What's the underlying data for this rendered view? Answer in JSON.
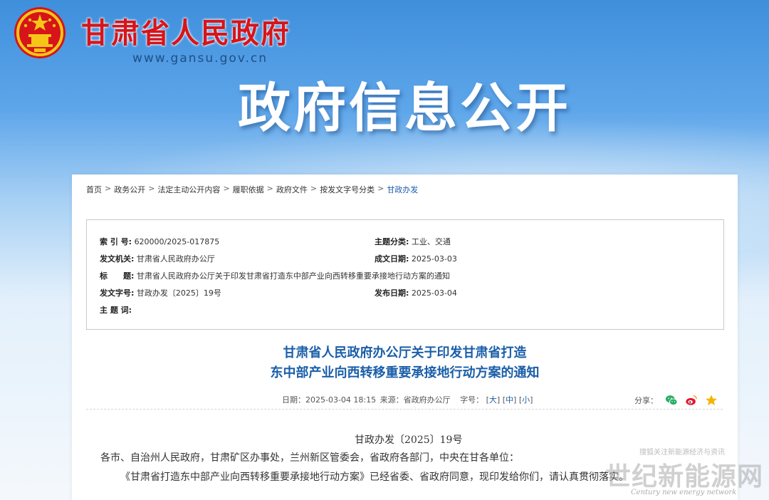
{
  "header": {
    "site_title": "甘肃省人民政府",
    "site_url": "www.gansu.gov.cn",
    "banner": "政府信息公开"
  },
  "breadcrumb": [
    "首页",
    "政务公开",
    "法定主动公开内容",
    "履职依据",
    "政府文件",
    "按发文字号分类",
    "甘政办发"
  ],
  "meta": {
    "index_label": "索 引 号:",
    "index_value": "620000/2025-017875",
    "topic_label": "主题分类:",
    "topic_value": "工业、交通",
    "issuer_label": "发文机关:",
    "issuer_value": "甘肃省人民政府办公厅",
    "written_label": "成文日期:",
    "written_value": "2025-03-03",
    "title_label": "标　　题:",
    "title_value": "甘肃省人民政府办公厅关于印发甘肃省打造东中部产业向西转移重要承接地行动方案的通知",
    "docno_label": "发文字号:",
    "docno_value": "甘政办发〔2025〕19号",
    "pubdate_label": "发布日期:",
    "pubdate_value": "2025-03-04",
    "keywords_label": "主 题 词:",
    "keywords_value": ""
  },
  "document": {
    "title_line1": "甘肃省人民政府办公厅关于印发甘肃省打造",
    "title_line2": "东中部产业向西转移重要承接地行动方案的通知",
    "info_date": "日期：2025-03-04 18:15",
    "info_source": "来源：省政府办公厅",
    "info_size_label": "字号：",
    "size_large": "大",
    "size_medium": "中",
    "size_small": "小",
    "share_label": "分享：",
    "doc_number": "甘政办发〔2025〕19号",
    "addressees": "各市、自治州人民政府，甘肃矿区办事处，兰州新区管委会，省政府各部门，中央在甘各单位：",
    "paragraph1": "《甘肃省打造东中部产业向西转移重要承接地行动方案》已经省委、省政府同意，现印发给你们，请认真贯彻落实。"
  },
  "watermark": {
    "small": "搜狐关注新能源经济与资讯",
    "big": "世纪新能源网",
    "english": "Century new energy network"
  },
  "colors": {
    "site_red": "#d7141a",
    "link_blue": "#1a5ea8",
    "wechat_green": "#2aae67",
    "weibo_red": "#e6162d",
    "star_gold": "#f4b400"
  },
  "icons": [
    "national-emblem-icon",
    "wechat-icon",
    "weibo-icon",
    "qzone-star-icon"
  ]
}
